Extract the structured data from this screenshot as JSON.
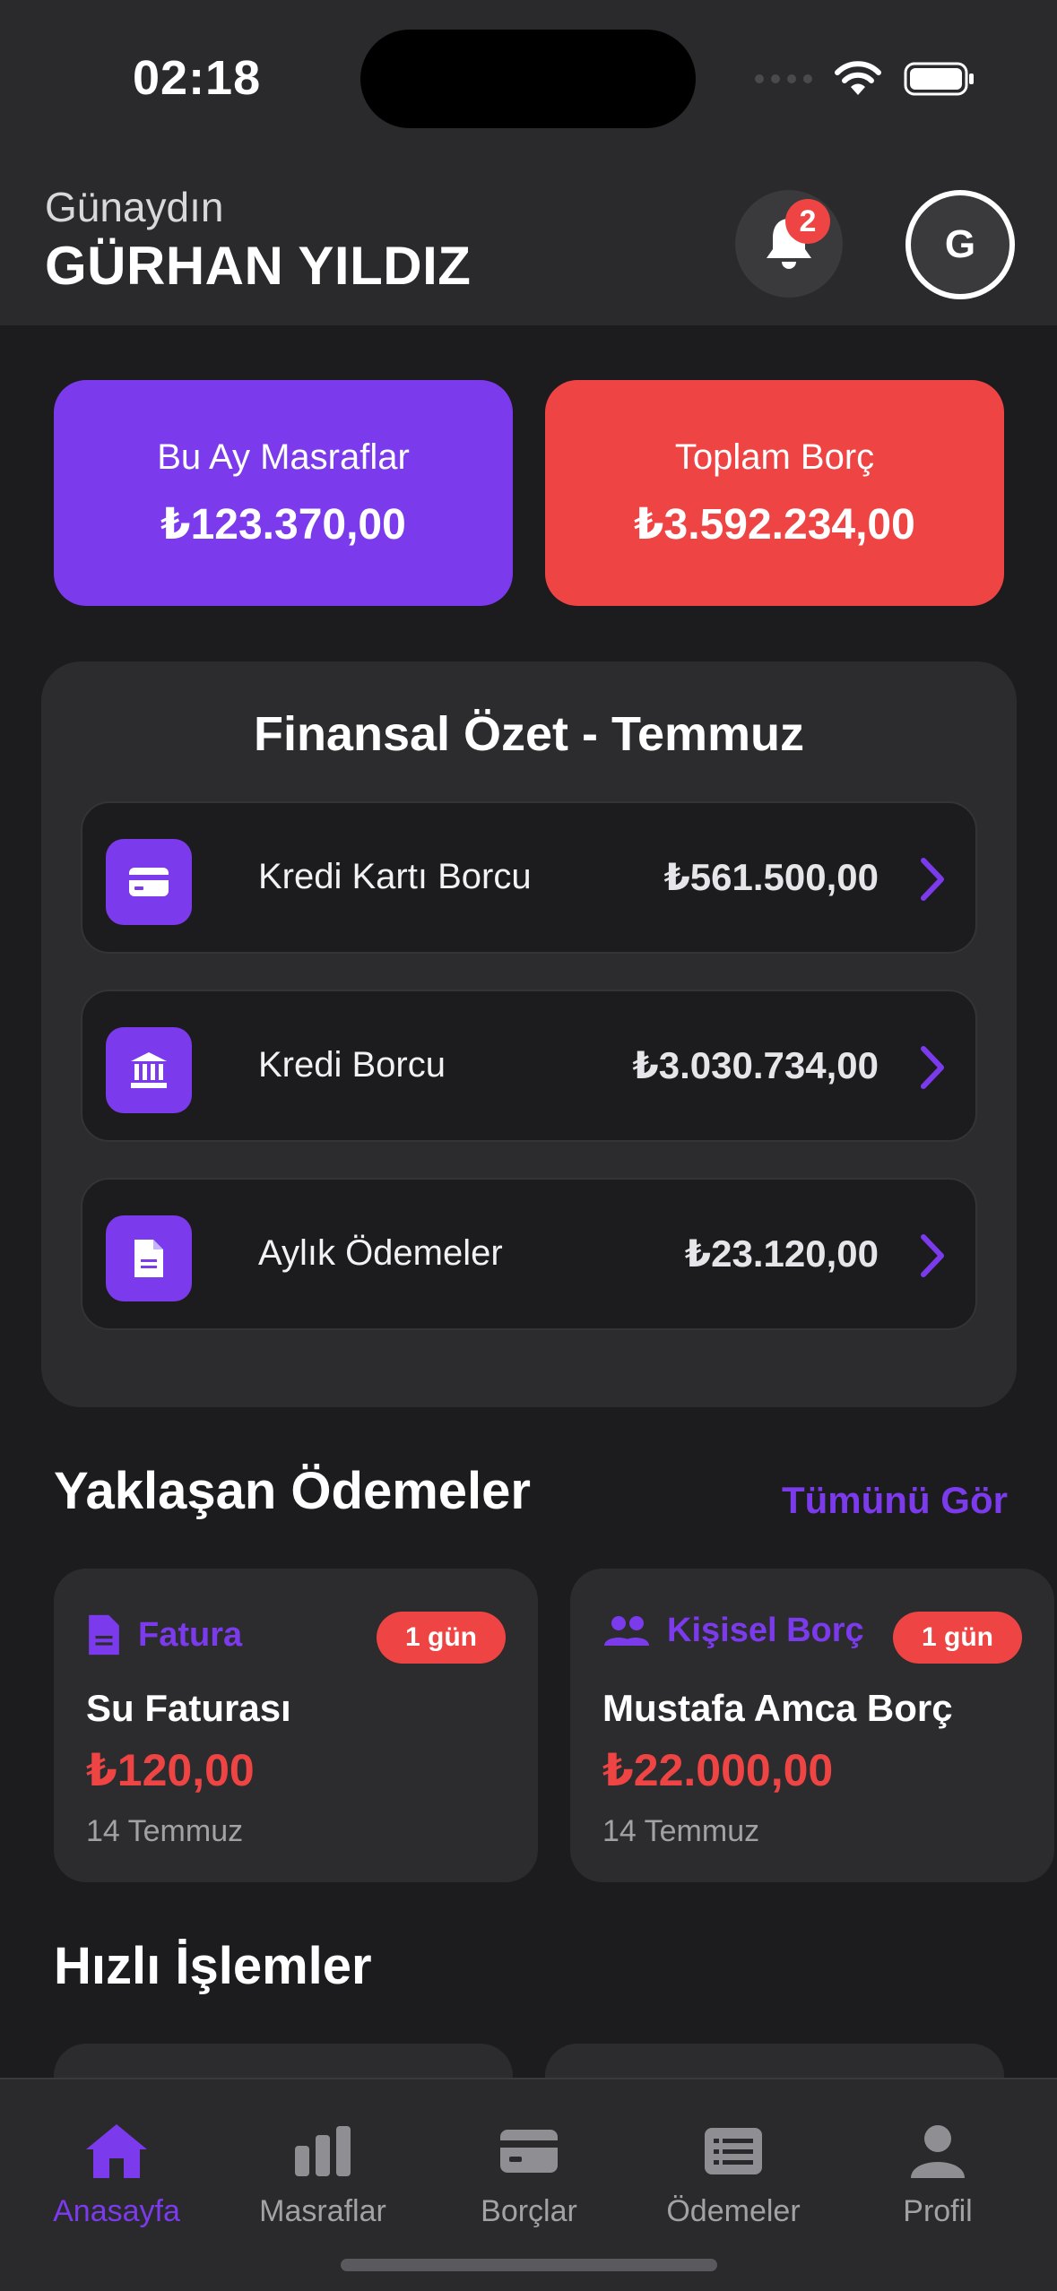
{
  "status_bar": {
    "time": "02:18"
  },
  "header": {
    "greeting": "Günaydın",
    "user_name": "GÜRHAN YILDIZ",
    "notification_count": "2",
    "avatar_initial": "G"
  },
  "summary": {
    "monthly_expenses": {
      "label": "Bu Ay Masraflar",
      "value": "₺123.370,00"
    },
    "total_debt": {
      "label": "Toplam Borç",
      "value": "₺3.592.234,00"
    }
  },
  "financial_summary": {
    "title": "Finansal Özet - Temmuz",
    "items": [
      {
        "label": "Kredi Kartı Borcu",
        "amount": "₺561.500,00",
        "icon": "credit-card-icon"
      },
      {
        "label": "Kredi Borcu",
        "amount": "₺3.030.734,00",
        "icon": "bank-icon"
      },
      {
        "label": "Aylık Ödemeler",
        "amount": "₺23.120,00",
        "icon": "document-icon"
      }
    ]
  },
  "upcoming": {
    "title": "Yaklaşan Ödemeler",
    "see_all": "Tümünü Gör",
    "items": [
      {
        "category": "Fatura",
        "badge": "1 gün",
        "title": "Su Faturası",
        "amount": "₺120,00",
        "date": "14 Temmuz",
        "icon": "document-icon"
      },
      {
        "category": "Kişisel Borç",
        "badge": "1 gün",
        "title": "Mustafa Amca Borç",
        "amount": "₺22.000,00",
        "date": "14 Temmuz",
        "icon": "people-icon"
      }
    ]
  },
  "quick_actions": {
    "title": "Hızlı İşlemler"
  },
  "tabbar": {
    "items": [
      {
        "label": "Anasayfa",
        "active": true
      },
      {
        "label": "Masraflar"
      },
      {
        "label": "Borçlar"
      },
      {
        "label": "Ödemeler"
      },
      {
        "label": "Profil"
      }
    ]
  },
  "colors": {
    "accent": "#7c3aed",
    "danger": "#ef4444",
    "background": "#1c1c1e",
    "surface": "#2c2c2e"
  }
}
